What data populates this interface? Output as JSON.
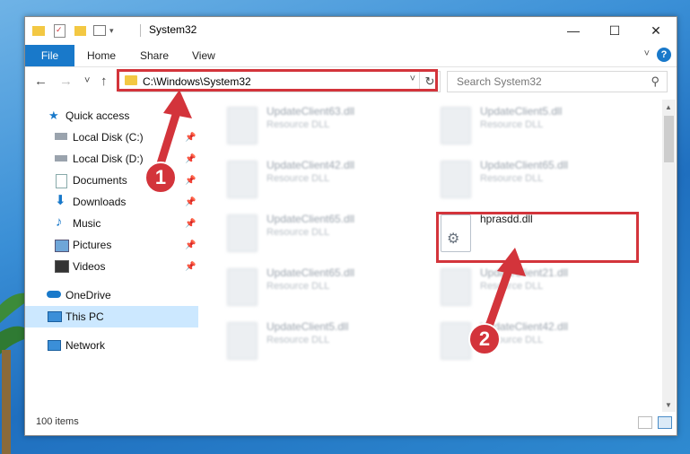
{
  "window": {
    "title": "System32",
    "controls": {
      "minimize": "—",
      "maximize": "☐",
      "close": "✕"
    }
  },
  "ribbon": {
    "tabs": [
      {
        "label": "File"
      },
      {
        "label": "Home"
      },
      {
        "label": "Share"
      },
      {
        "label": "View"
      }
    ],
    "help": "?"
  },
  "navigation": {
    "back": "←",
    "forward": "→",
    "recent": "˅",
    "up": "↑",
    "address": "C:\\Windows\\System32",
    "refresh": "↻",
    "search_placeholder": "Search System32"
  },
  "sidebar": {
    "items": [
      {
        "label": "Quick access",
        "icon": "star-icon",
        "pinned": false
      },
      {
        "label": "Local Disk (C:)",
        "icon": "drive-icon",
        "pinned": true
      },
      {
        "label": "Local Disk (D:)",
        "icon": "drive-icon",
        "pinned": true
      },
      {
        "label": "Documents",
        "icon": "documents-icon",
        "pinned": true
      },
      {
        "label": "Downloads",
        "icon": "downloads-icon",
        "pinned": true
      },
      {
        "label": "Music",
        "icon": "music-icon",
        "pinned": true
      },
      {
        "label": "Pictures",
        "icon": "pictures-icon",
        "pinned": true
      },
      {
        "label": "Videos",
        "icon": "videos-icon",
        "pinned": true
      },
      {
        "label": "OneDrive",
        "icon": "cloud-icon",
        "pinned": false
      },
      {
        "label": "This PC",
        "icon": "computer-icon",
        "pinned": false,
        "selected": true
      },
      {
        "label": "Network",
        "icon": "network-icon",
        "pinned": false
      }
    ]
  },
  "files": [
    {
      "name": "UpdateClient63.dll",
      "type": "Resource DLL"
    },
    {
      "name": "UpdateClient5.dll",
      "type": "Resource DLL"
    },
    {
      "name": "UpdateClient42.dll",
      "type": "Resource DLL"
    },
    {
      "name": "UpdateClient65.dll",
      "type": "Resource DLL"
    },
    {
      "name": "UpdateClient65.dll",
      "type": "Resource DLL"
    },
    {
      "name": "hprasdd.dll",
      "type": ""
    },
    {
      "name": "UpdateClient65.dll",
      "type": "Resource DLL"
    },
    {
      "name": "UpdateClient21.dll",
      "type": "Resource DLL"
    },
    {
      "name": "UpdateClient5.dll",
      "type": "Resource DLL"
    },
    {
      "name": "UpdateClient42.dll",
      "type": "Resource DLL"
    }
  ],
  "status": {
    "item_count": "100 items"
  },
  "annotations": [
    {
      "label": "1"
    },
    {
      "label": "2"
    }
  ],
  "colors": {
    "accent": "#1979ca",
    "highlight": "#d3343b",
    "selection": "#cce8ff"
  }
}
